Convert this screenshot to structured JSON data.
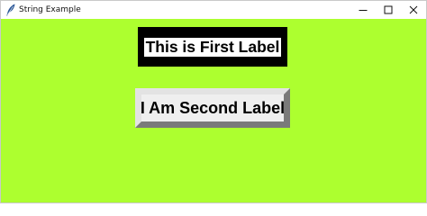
{
  "window": {
    "title": "String Example",
    "icon": "feather-icon",
    "controls": [
      "minimize-icon",
      "maximize-icon",
      "close-icon"
    ]
  },
  "labels": {
    "first": "This is First Label",
    "second": "I Am Second Label"
  },
  "colors": {
    "canvas_background": "#adff2f",
    "first_label_border": "#000000",
    "first_label_background": "#ffffff",
    "second_label_background": "#efefef",
    "text": "#000000"
  }
}
